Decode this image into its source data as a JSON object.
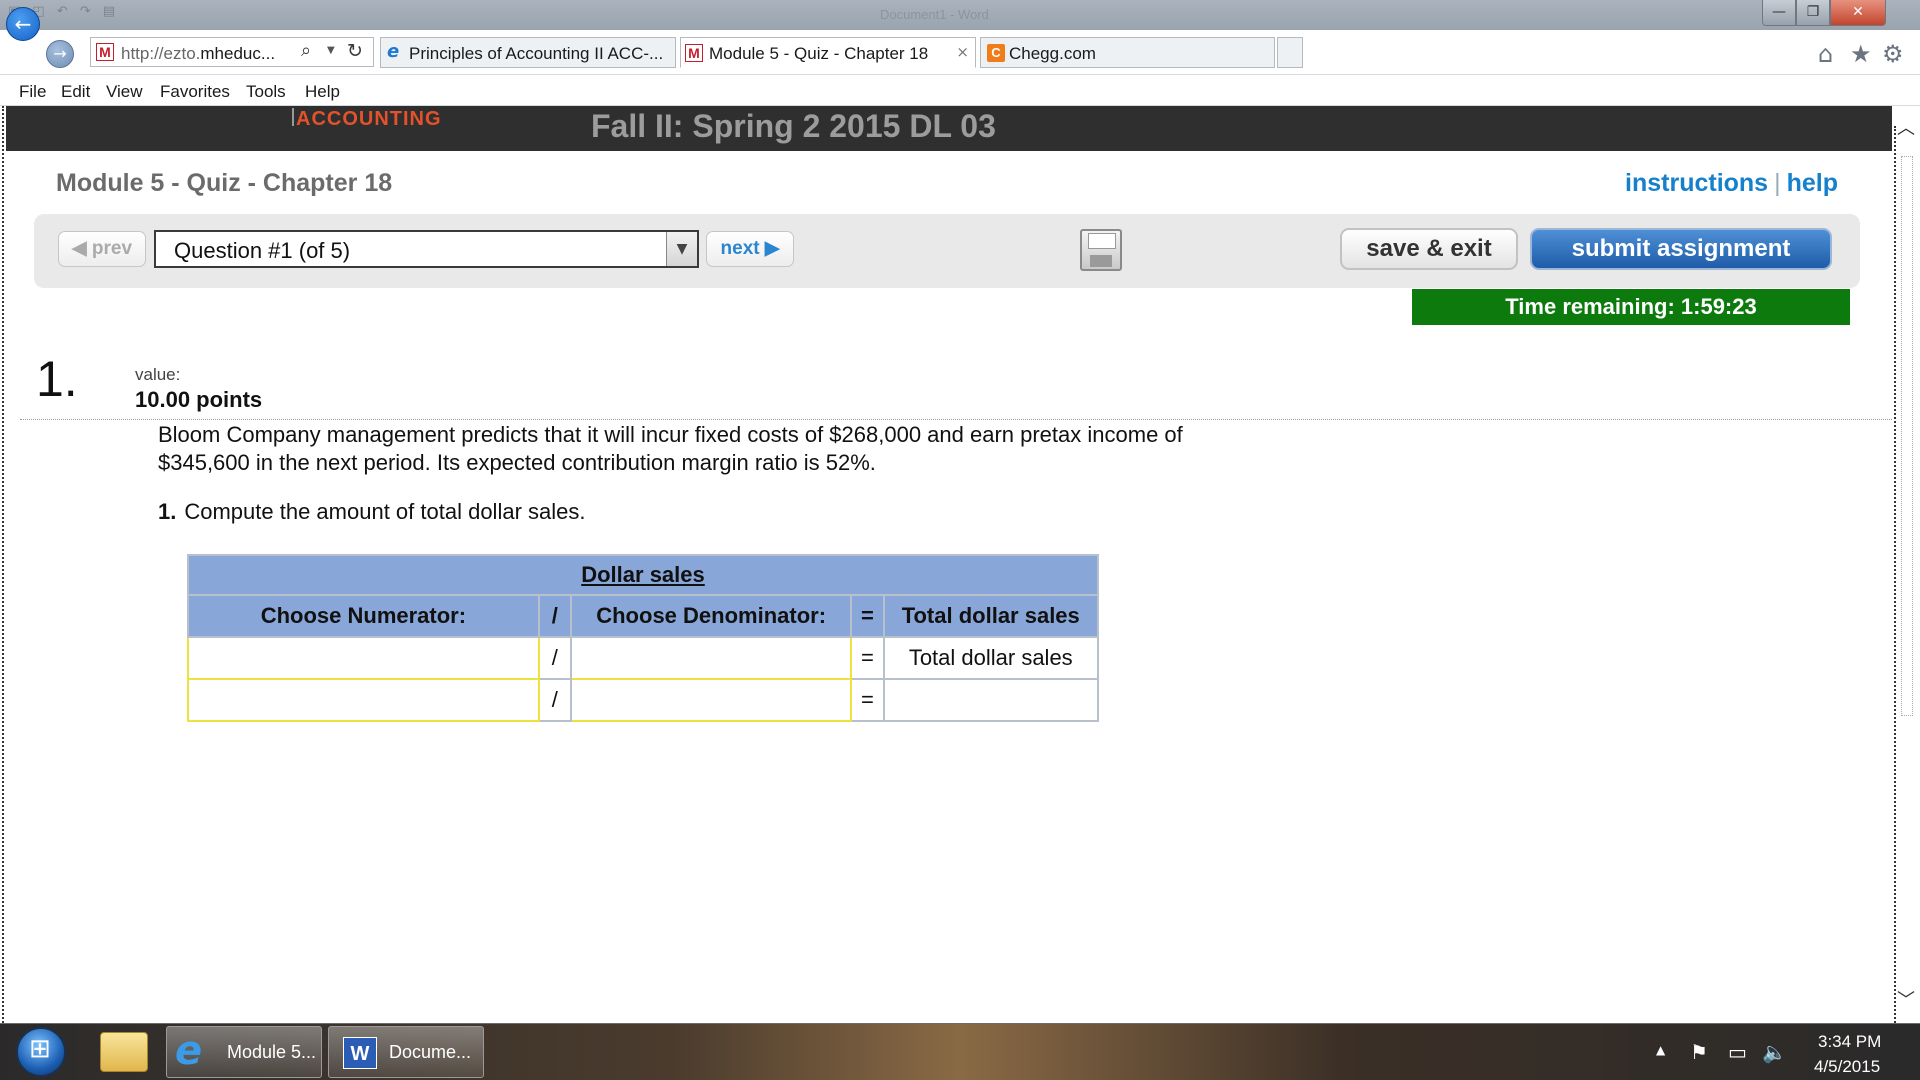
{
  "window": {
    "ghost_title": "Document1 - Word",
    "controls": {
      "minimize": "—",
      "maximize": "❐",
      "close": "✕"
    }
  },
  "browser": {
    "address": {
      "prefix": "http://ezto.",
      "host": "mheduc...",
      "icon": "mcgraw-hill-m-logo"
    },
    "tabs": [
      {
        "label": "Principles of Accounting II ACC-...",
        "icon": "ie-logo",
        "active": false
      },
      {
        "label": "Module 5 - Quiz - Chapter 18",
        "icon": "mcgraw-hill-m-logo",
        "active": true,
        "close": "×"
      },
      {
        "label": "Chegg.com",
        "icon": "chegg-logo",
        "active": false
      }
    ],
    "toolbar_icons": {
      "home": "⌂",
      "favorites": "★",
      "settings": "⚙"
    },
    "menu": [
      "File",
      "Edit",
      "View",
      "Favorites",
      "Tools",
      "Help"
    ]
  },
  "page": {
    "brand": "ACCOUNTING",
    "course_title": "Fall II: Spring 2 2015 DL 03",
    "module_title": "Module 5 - Quiz - Chapter 18",
    "links": {
      "instructions": "instructions",
      "separator": "|",
      "help": "help"
    },
    "nav": {
      "prev": "◀ prev",
      "question_select": "Question #1 (of 5)",
      "next": "next ▶",
      "save_exit": "save & exit",
      "submit": "submit assignment"
    },
    "timer": "Time remaining: 1:59:23",
    "question": {
      "number": "1.",
      "value_label": "value:",
      "points": "10.00 points",
      "text": "Bloom Company management predicts that it will incur fixed costs of $268,000 and earn pretax income of $345,600 in the next period. Its expected contribution margin ratio is 52%.",
      "sub_number": "1.",
      "sub_text": "Compute the amount of total dollar sales."
    },
    "table": {
      "title": "Dollar sales",
      "headers": [
        "Choose Numerator:",
        "/",
        "Choose Denominator:",
        "=",
        "Total dollar sales"
      ],
      "rows": [
        {
          "numerator": "",
          "div": "/",
          "denominator": "",
          "eq": "=",
          "result": "Total dollar sales"
        },
        {
          "numerator": "",
          "div": "/",
          "denominator": "",
          "eq": "=",
          "result": ""
        }
      ]
    }
  },
  "taskbar": {
    "buttons": [
      {
        "label": "Module 5...",
        "icon": "ie-logo"
      },
      {
        "label": "Docume...",
        "icon": "word-logo"
      }
    ],
    "clock": {
      "time": "3:34 PM",
      "date": "4/5/2015"
    }
  }
}
